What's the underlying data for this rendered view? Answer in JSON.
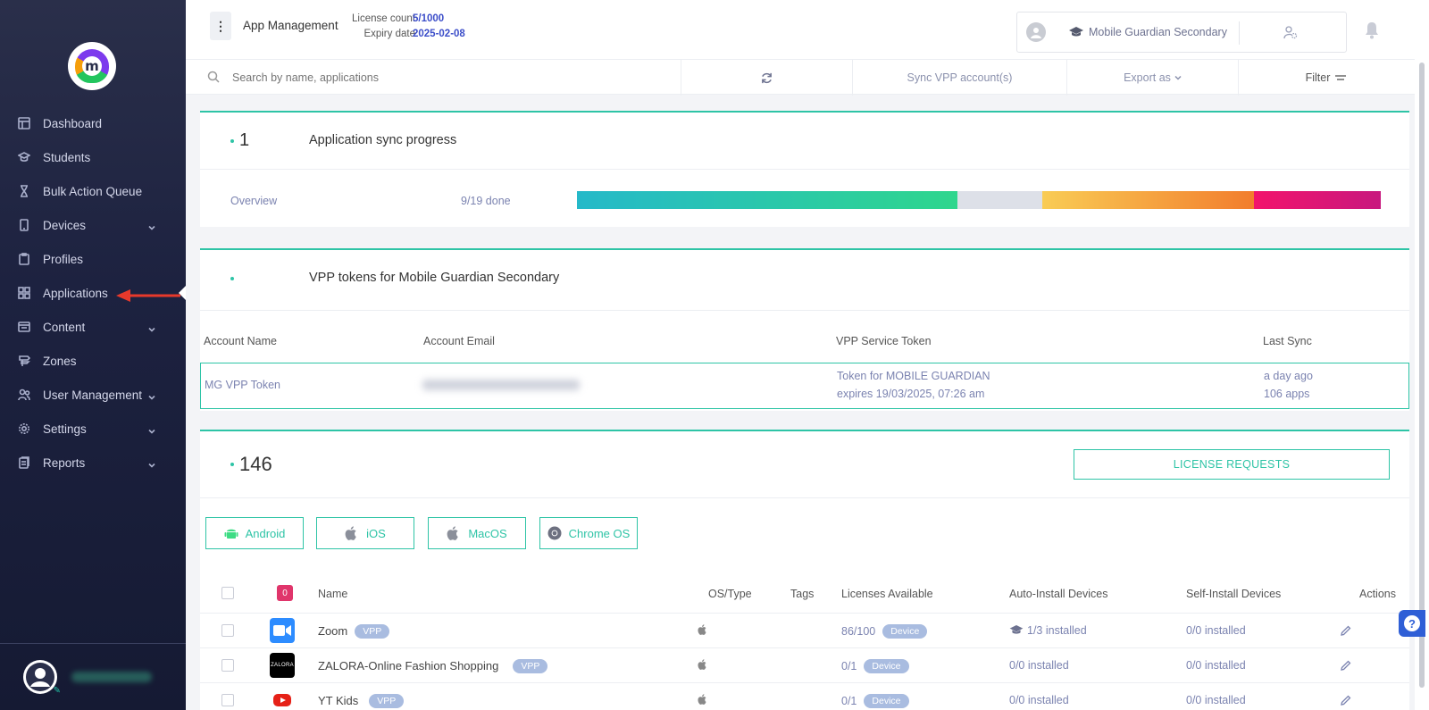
{
  "sidebar": {
    "items": [
      {
        "label": "Dashboard",
        "icon": "dashboard-icon",
        "chevron": false
      },
      {
        "label": "Students",
        "icon": "students-icon",
        "chevron": false
      },
      {
        "label": "Bulk Action Queue",
        "icon": "hourglass-icon",
        "chevron": false
      },
      {
        "label": "Devices",
        "icon": "device-icon",
        "chevron": true
      },
      {
        "label": "Profiles",
        "icon": "profiles-icon",
        "chevron": false
      },
      {
        "label": "Applications",
        "icon": "grid-icon",
        "chevron": false,
        "active": true
      },
      {
        "label": "Content",
        "icon": "content-icon",
        "chevron": true
      },
      {
        "label": "Zones",
        "icon": "zones-icon",
        "chevron": false
      },
      {
        "label": "User Management",
        "icon": "users-icon",
        "chevron": true
      },
      {
        "label": "Settings",
        "icon": "gear-icon",
        "chevron": true
      },
      {
        "label": "Reports",
        "icon": "reports-icon",
        "chevron": true
      }
    ],
    "arrow_color": "#e8392b"
  },
  "header": {
    "title": "App Management",
    "license_label": "License count",
    "license_value": "5/1000",
    "expiry_label": "Expiry date",
    "expiry_value": "2025-02-08",
    "school_name": "Mobile Guardian Secondary"
  },
  "toolbar": {
    "search_placeholder": "Search by name, applications",
    "sync_label": "Sync VPP account(s)",
    "export_label": "Export as",
    "filter_label": "Filter"
  },
  "sync_card": {
    "count": "1",
    "title": "Application sync progress",
    "overview_label": "Overview",
    "done_label": "9/19 done",
    "segments": [
      {
        "fraction": 0.473,
        "colors": [
          "#25b9c9",
          "#2fd68d"
        ]
      },
      {
        "fraction": 0.106,
        "colors": [
          "#dde0e8",
          "#dde0e8"
        ]
      },
      {
        "fraction": 0.263,
        "colors": [
          "#f9cc55",
          "#f27d2d"
        ]
      },
      {
        "fraction": 0.158,
        "colors": [
          "#f2146c",
          "#c8187e"
        ]
      }
    ]
  },
  "vpp_card": {
    "title": "VPP tokens for Mobile Guardian Secondary",
    "headers": {
      "account_name": "Account Name",
      "account_email": "Account Email",
      "token": "VPP Service Token",
      "last_sync": "Last Sync"
    },
    "row": {
      "account_name": "MG VPP Token",
      "token_line1": "Token for MOBILE GUARDIAN",
      "token_line2": "expires 19/03/2025, 07:26 am",
      "sync_line1": "a day ago",
      "sync_line2": "106 apps"
    }
  },
  "apps_card": {
    "count": "146",
    "license_requests_label": "LICENSE REQUESTS",
    "os_buttons": [
      {
        "label": "Android",
        "icon": "android-icon"
      },
      {
        "label": "iOS",
        "icon": "apple-icon"
      },
      {
        "label": "MacOS",
        "icon": "apple-icon"
      },
      {
        "label": "Chrome OS",
        "icon": "chrome-icon"
      }
    ],
    "selected_count": "0",
    "columns": {
      "name": "Name",
      "os_type": "OS/Type",
      "tags": "Tags",
      "licenses": "Licenses Available",
      "auto_install": "Auto-Install Devices",
      "self_install": "Self-Install Devices",
      "actions": "Actions"
    },
    "rows": [
      {
        "name": "Zoom",
        "tag": "VPP",
        "licenses": "86/100",
        "license_type": "Device",
        "auto": "1/3 installed",
        "self": "0/0 installed",
        "auto_icon": true
      },
      {
        "name": "ZALORA-Online Fashion Shopping",
        "tag": "VPP",
        "licenses": "0/1",
        "license_type": "Device",
        "auto": "0/0 installed",
        "self": "0/0 installed",
        "auto_icon": false
      },
      {
        "name": "YT Kids",
        "tag": "VPP",
        "licenses": "0/1",
        "license_type": "Device",
        "auto": "0/0 installed",
        "self": "0/0 installed",
        "auto_icon": false
      }
    ]
  },
  "colors": {
    "accent": "#2ec4a6",
    "sidebar_bg": "#1d2240",
    "link": "#7b83b0",
    "badge": "#e0356b"
  }
}
